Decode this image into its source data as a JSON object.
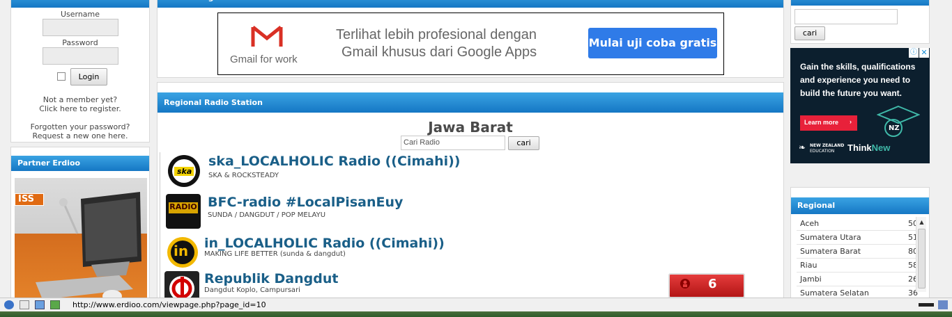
{
  "login": {
    "username_label": "Username",
    "password_label": "Password",
    "login_button": "Login",
    "register_line1": "Not a member yet?",
    "register_line2": "Click here to register.",
    "forgot_line1": "Forgotten your password?",
    "forgot_line2": "Request a new one here."
  },
  "partner": {
    "title": "Partner Erdioo",
    "iss_label": "ISS"
  },
  "advertising": {
    "title": "Advertising",
    "gmail_label": "Gmail for work",
    "line1": "Terlihat lebih profesional dengan",
    "line2": "Gmail khusus dari Google Apps",
    "cta": "Mulai uji coba gratis"
  },
  "radio": {
    "title": "Regional Radio Station",
    "region": "Jawa Barat",
    "search_placeholder": "Cari Radio",
    "search_button": "cari",
    "stations": [
      {
        "name": "ska_LOCALHOLIC Radio ((Cimahi))",
        "genre": "SKA & ROCKSTEADY",
        "logo_text": "ska"
      },
      {
        "name": "BFC-radio #LocalPisanEuy",
        "genre": "SUNDA / DANGDUT / POP MELAYU",
        "logo_text": "RADIO"
      },
      {
        "name": "in_LOCALHOLIC Radio ((Cimahi))",
        "genre": "MAKING LIFE BETTER (sunda & dangdut)",
        "logo_text": "in"
      },
      {
        "name": "Republik Dangdut",
        "genre": "Dangdut Koplo, Campursari",
        "logo_text": ""
      }
    ],
    "counter": "6"
  },
  "right_search": {
    "button": "cari"
  },
  "nz_ad": {
    "line1": "Gain the skills, qualifications",
    "line2": "and experience you need to",
    "line3": "build the future you want.",
    "learn_more": "Learn more",
    "nz_badge": "NZ",
    "brand_small": "NEW ZEALAND",
    "brand_small2": "EDUCATION",
    "brand_think": "Think",
    "brand_new": "New"
  },
  "regional": {
    "title": "Regional",
    "items": [
      {
        "name": "Aceh",
        "count": "50"
      },
      {
        "name": "Sumatera Utara",
        "count": "51"
      },
      {
        "name": "Sumatera Barat",
        "count": "80"
      },
      {
        "name": "Riau",
        "count": "58"
      },
      {
        "name": "Jambi",
        "count": "26"
      },
      {
        "name": "Sumatera Selatan",
        "count": "36"
      }
    ]
  },
  "status_bar": {
    "url": "http://www.erdioo.com/viewpage.php?page_id=10"
  },
  "colors": {
    "header_blue": "#1a7fcb",
    "link_blue": "#1a5f88",
    "cta_blue": "#2f7be8"
  }
}
